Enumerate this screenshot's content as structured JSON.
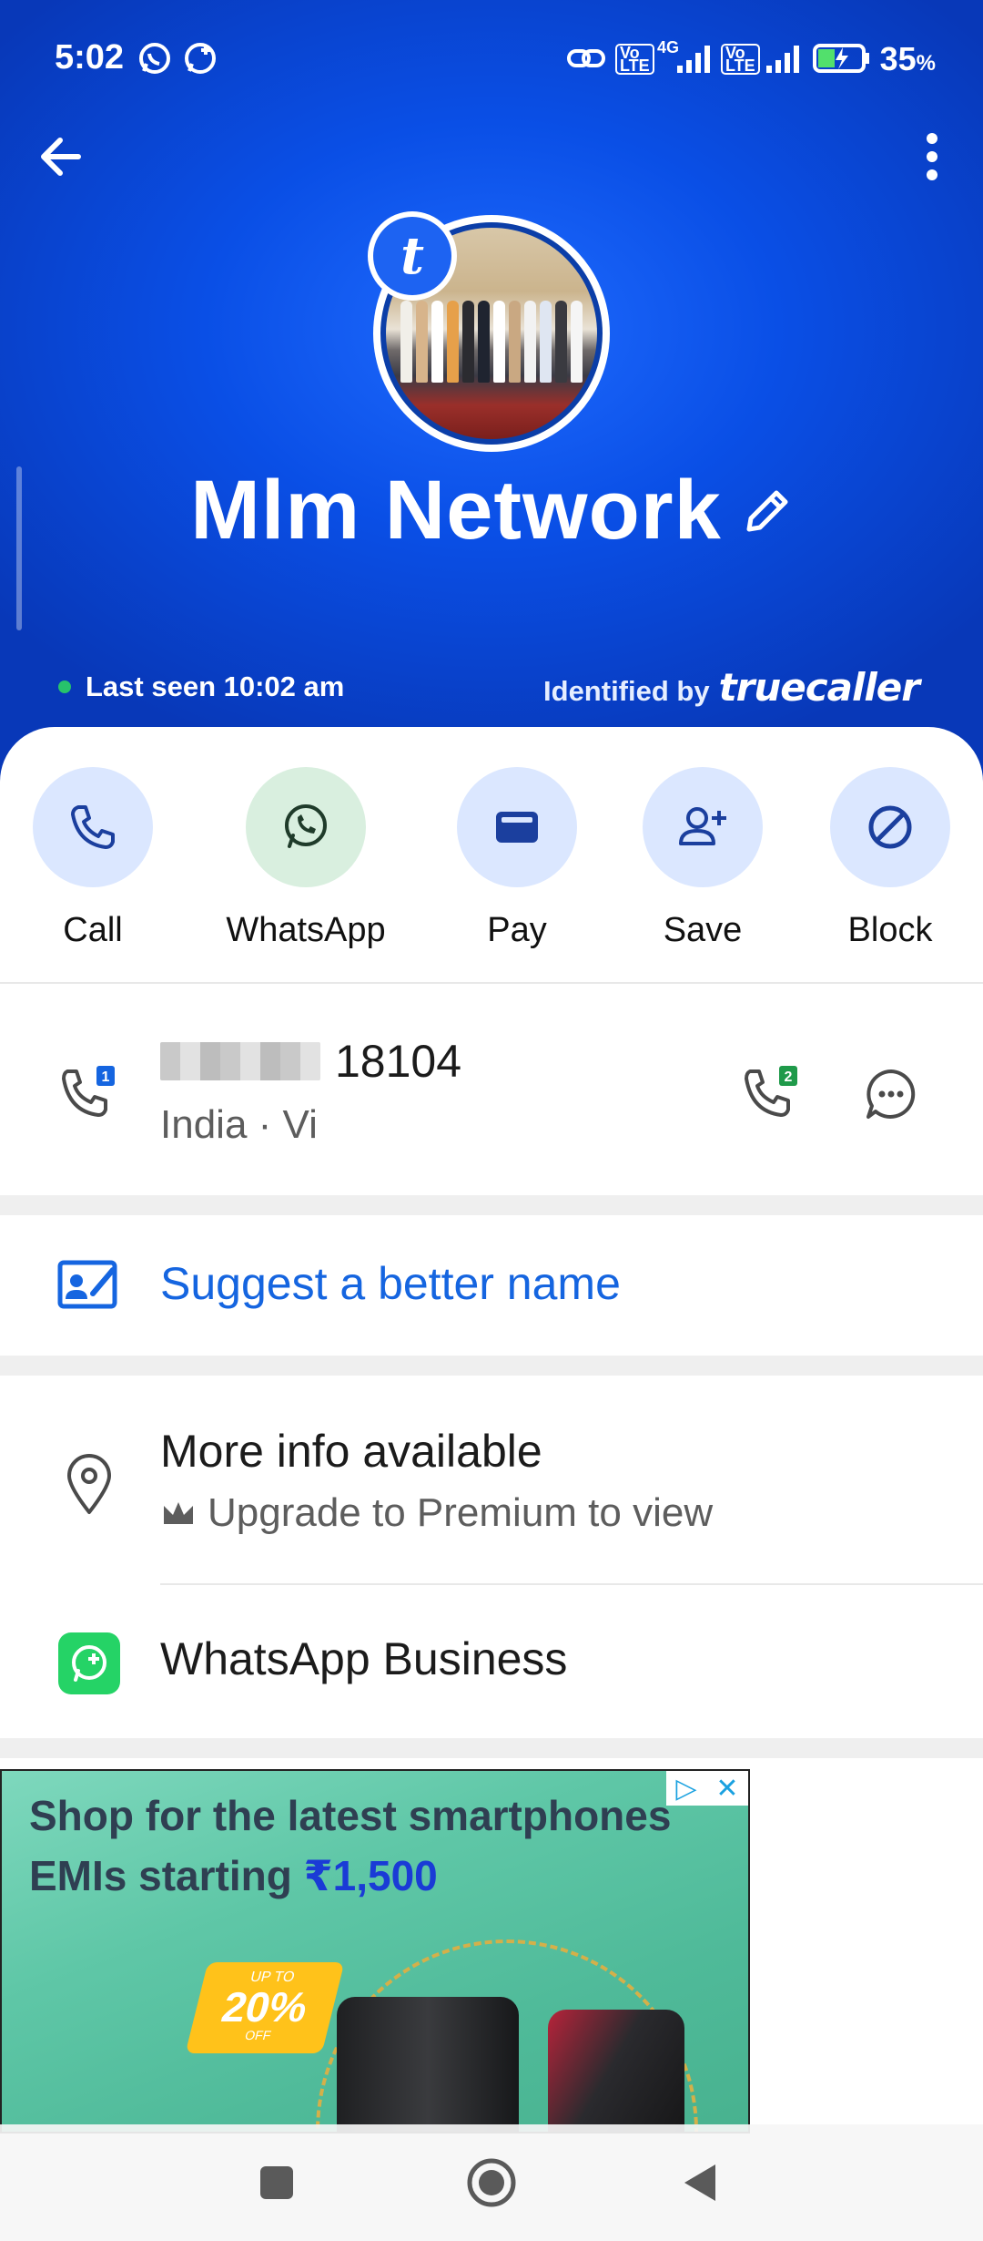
{
  "status_bar": {
    "time": "5:02",
    "battery_percent": "35",
    "battery_unit": "%",
    "network": "4G",
    "volte_label": "Vo\nLTE"
  },
  "header": {
    "contact_name": "Mlm Network",
    "last_seen": "Last seen 10:02 am",
    "identified_prefix": "Identified by",
    "identified_brand": "truecaller",
    "badge_letter": "t",
    "background_color": "#0a4fe6"
  },
  "actions": [
    {
      "label": "Call",
      "icon": "phone-icon"
    },
    {
      "label": "WhatsApp",
      "icon": "whatsapp-icon"
    },
    {
      "label": "Pay",
      "icon": "wallet-icon"
    },
    {
      "label": "Save",
      "icon": "add-contact-icon"
    },
    {
      "label": "Block",
      "icon": "block-icon"
    }
  ],
  "phone": {
    "number_visible": "18104",
    "carrier": "India · Vi",
    "sim1_label": "1",
    "sim2_label": "2"
  },
  "suggest": {
    "label": "Suggest a better name",
    "color": "#1565e0"
  },
  "more_info": {
    "title": "More info available",
    "subtitle": "Upgrade to Premium to view"
  },
  "whatsapp_business": {
    "label": "WhatsApp Business"
  },
  "ad": {
    "line1": "Shop for the latest smartphones",
    "line2_prefix": "EMIs starting ",
    "line2_price": "₹1,500",
    "badge_upto": "UP TO",
    "badge_pct": "20%",
    "badge_off": "OFF"
  }
}
